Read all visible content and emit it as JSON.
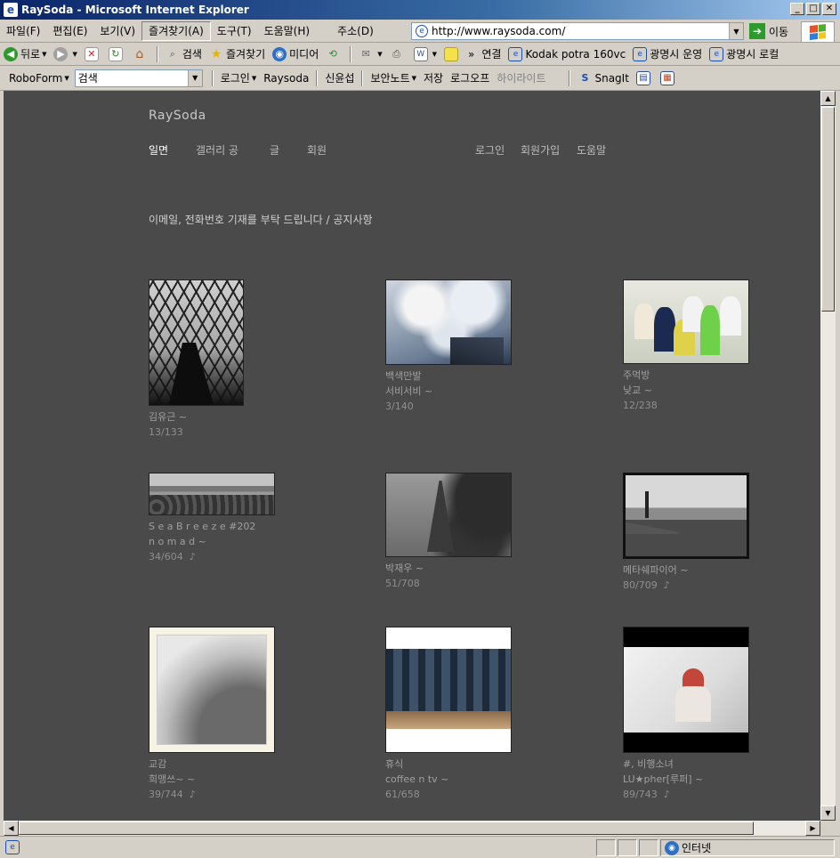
{
  "window": {
    "title": "RaySoda - Microsoft Internet Explorer",
    "min": "_",
    "max": "□",
    "close": "✕"
  },
  "menu": {
    "items": [
      "파일(F)",
      "편집(E)",
      "보기(V)",
      "즐겨찾기(A)",
      "도구(T)",
      "도움말(H)"
    ],
    "address_label": "주소(D)",
    "url": "http://www.raysoda.com/",
    "go": "이동"
  },
  "toolbar1": {
    "back": "뒤로",
    "search": "검색",
    "favorites": "즐겨찾기",
    "media": "미디어",
    "chevron": "»",
    "links_label": "연결",
    "links": [
      "Kodak potra 160vc",
      "광명시 운영",
      "광명시 로컬"
    ]
  },
  "toolbar2": {
    "roboform": "RoboForm",
    "search_value": "검색",
    "login": "로그인",
    "raysoda": "Raysoda",
    "sinyun": "신윤섭",
    "security_note": "보안노트",
    "save": "저장",
    "logoff": "로그오프",
    "highlight": "하이라이트",
    "snagit": "SnagIt"
  },
  "site": {
    "title": "RaySoda",
    "nav": [
      "일면",
      "갤러리 공",
      "글",
      "회원"
    ],
    "nav_right": [
      "로그인",
      "회원가입",
      "도움말"
    ],
    "notice": "이메일, 전화번호 기재를 부탁 드립니다 / 공지사항"
  },
  "gallery": [
    {
      "title": "",
      "author": "김유근 ~",
      "stat": "13/133",
      "note": false
    },
    {
      "title": "백색만발",
      "author": "서비서비 ~",
      "stat": "3/140",
      "note": false
    },
    {
      "title": "주먹방",
      "author": "낮교 ~",
      "stat": "12/238",
      "note": false
    },
    {
      "title": "S e a B r e e z e #202",
      "author": "n o m a d ~",
      "stat": "34/604",
      "note": true
    },
    {
      "title": "",
      "author": "박재우 ~",
      "stat": "51/708",
      "note": false
    },
    {
      "title": "",
      "author": "메타쉐파이어 ~",
      "stat": "80/709",
      "note": true
    },
    {
      "title": "교감",
      "author": "희맹쓰~ ~",
      "stat": "39/744",
      "note": true
    },
    {
      "title": "휴식",
      "author": "coffee n tv ~",
      "stat": "61/658",
      "note": false
    },
    {
      "title": "#, 비행소녀",
      "author": "LU★pher[루퍼] ~",
      "stat": "89/743",
      "note": true
    }
  ],
  "status": {
    "zone": "인터넷"
  },
  "icons": {
    "note": "♪"
  }
}
